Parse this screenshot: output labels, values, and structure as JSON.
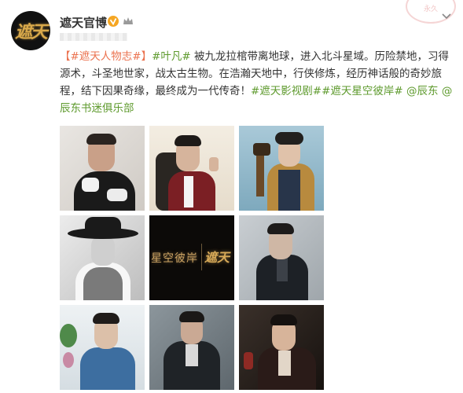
{
  "header": {
    "username": "遮天官博",
    "avatar_text": "遮天",
    "watermark_text": "永久"
  },
  "content": {
    "tag_open": "【",
    "tag_text": "#遮天人物志#",
    "tag_close": "】",
    "topic_1": "#叶凡#",
    "body_1": " 被九龙拉棺带离地球，进入北斗星域。历险禁地，习得源术，斗圣地世家，战太古生物。在浩瀚天地中，行侠修炼，经历神话般的奇妙旅程，结下因果奇缘，最终成为一代传奇！",
    "topic_2": "#遮天影视剧#",
    "topic_3": "#遮天星空彼岸#",
    "mention_1": "@辰东",
    "mention_2": "@辰东书迷俱乐部"
  },
  "grid": {
    "title_card_left": "星空彼岸",
    "title_card_right": "遮天"
  },
  "colors": {
    "topic": "#5e9a2d",
    "tag": "#eb7350",
    "verified": "#f5a623"
  }
}
